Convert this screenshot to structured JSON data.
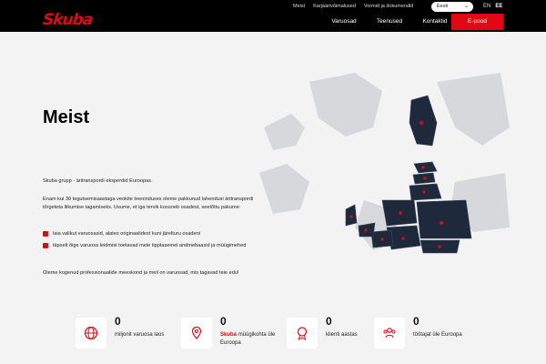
{
  "header": {
    "logo": "Skuba",
    "top_links": [
      "Meist",
      "Karjäärivõimalused",
      "Vormid ja dokumendid"
    ],
    "language_select": "Eesti",
    "lang_codes": [
      "EN",
      "EE"
    ],
    "nav": [
      "Varuosad",
      "Teenused",
      "Kontaktid"
    ],
    "cta": "E-pood"
  },
  "main": {
    "title": "Meist",
    "intro": "Skuba grupp - äritranspordi eksperdid Euroopas.",
    "para1": "Enam kui 30 tegutsemisaastaga veokite teeninduses oleme pakkunud lahendusi äritranspordi tõrgeteta liikumise tagamiseks. Usume, et iga tervik koosneb osadest, seetõttu pakume:",
    "bullets": [
      "laia valikut varuosasid, alates originaalidest kuni järelturu osadeni",
      "täpselt õige varuosa leidmist toetavad meie tipptasemel andmebaasid ja müügimehed"
    ],
    "para2": "Oleme kogenud professionaalide meeskond ja meil on varuosad, mis tagavad teie edu!"
  },
  "stats": [
    {
      "num": "0",
      "label": "miljonit varuosa laos",
      "icon": "globe-icon"
    },
    {
      "num": "0",
      "label_brand": "Skuba",
      "label": "müügikohta üle Euroopa",
      "icon": "location-pin-icon"
    },
    {
      "num": "0",
      "label": "klienti aastas",
      "icon": "award-badge-icon"
    },
    {
      "num": "0",
      "label": "töötajat üle Euroopa",
      "icon": "people-icon"
    }
  ],
  "colors": {
    "accent": "#e30613",
    "map_highlight": "#1e2a3b",
    "map_base": "#d6d8dc"
  }
}
